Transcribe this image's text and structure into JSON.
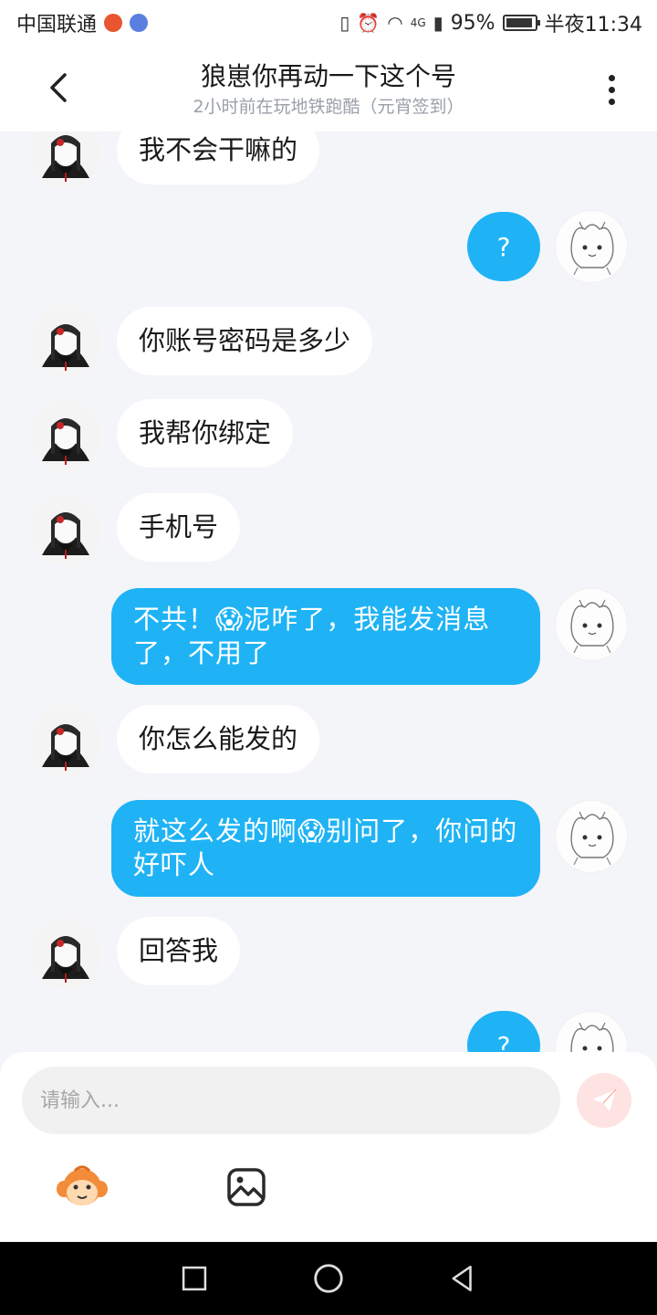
{
  "status_bar": {
    "carrier": "中国联通",
    "network": "4G",
    "battery": "95%",
    "time": "半夜11:34"
  },
  "header": {
    "title": "狼崽你再动一下这个号",
    "subtitle": "2小时前在玩地铁跑酷（元宵签到）"
  },
  "messages": [
    {
      "side": "in",
      "text": "我不会干嘛的"
    },
    {
      "side": "out",
      "text": "?"
    },
    {
      "side": "in",
      "text": "你账号密码是多少"
    },
    {
      "side": "in",
      "text": "我帮你绑定"
    },
    {
      "side": "in",
      "text": "手机号"
    },
    {
      "side": "out",
      "text": "不共！😱泥咋了，我能发消息了，不用了"
    },
    {
      "side": "in",
      "text": "你怎么能发的"
    },
    {
      "side": "out",
      "text": "就这么发的啊😱别问了，你问的好吓人"
    },
    {
      "side": "in",
      "text": "回答我"
    },
    {
      "side": "out",
      "text": "?"
    }
  ],
  "composer": {
    "placeholder": "请输入..."
  },
  "colors": {
    "outgoing_bubble": "#1fb3f5",
    "incoming_bubble": "#ffffff",
    "send_button": "#fde3e1",
    "background": "#f4f5f9"
  },
  "icons": {
    "back": "chevron-left-icon",
    "more": "more-vertical-icon",
    "send": "paper-plane-icon",
    "emoji": "monkey-emoji-icon",
    "image": "image-icon"
  }
}
